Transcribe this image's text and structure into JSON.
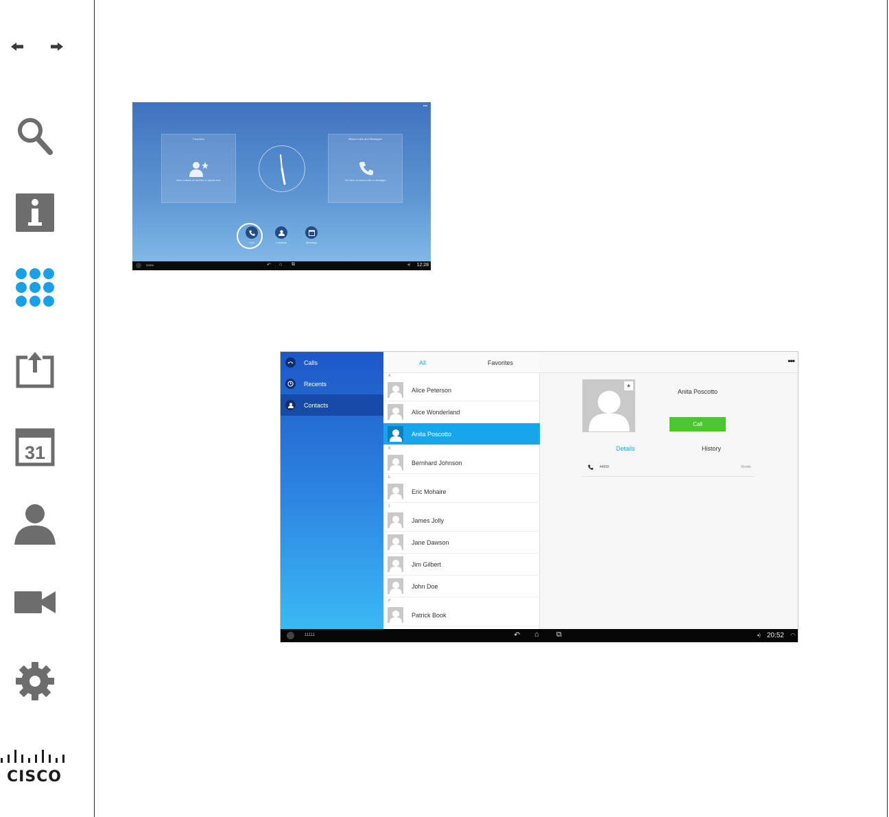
{
  "sidebar": {
    "icons": [
      "arrow-left-icon",
      "arrow-right-icon",
      "search-icon",
      "info-icon",
      "keypad-icon",
      "share-icon",
      "calendar-icon",
      "contact-icon",
      "camera-icon",
      "gear-icon"
    ],
    "calendar_number": "31",
    "info_letter": "i",
    "logo_text": "CISCO",
    "accent": "#1aa0e6",
    "icon_color": "#6d6d6d"
  },
  "home": {
    "panel_left": {
      "title": "Favorites",
      "text": "Mark contacts as favorites to appear here"
    },
    "panel_right": {
      "title": "Missed calls and Messages",
      "text": "You have no missed calls or messages"
    },
    "actions": [
      {
        "label": "Call",
        "icon": "phone-icon"
      },
      {
        "label": "Contacts",
        "icon": "contact-icon"
      },
      {
        "label": "Meetings",
        "icon": "calendar-icon"
      }
    ],
    "status": {
      "left": "92800",
      "time": "12:28"
    }
  },
  "contacts": {
    "tabs": [
      "Calls",
      "Recents",
      "Contacts"
    ],
    "selected_tab": "Contacts",
    "segments": {
      "all": "All",
      "favorites": "Favorites"
    },
    "letters": {
      "a": "A",
      "b": "B",
      "e": "E",
      "j": "J",
      "p": "P"
    },
    "list": [
      "Alice Peterson",
      "Alice Wonderland",
      "Anita Poscotto",
      "Bernhard Johnson",
      "Eric Mohaire",
      "James Jolly",
      "Jane Dawson",
      "Jim Gilbert",
      "John Doe",
      "Patrick Book"
    ],
    "selected_contact": "Anita Poscotto",
    "detail": {
      "name": "Anita Poscotto",
      "call_label": "Call",
      "tab_details": "Details",
      "tab_history": "History",
      "number": "44600",
      "number_type": "Mobile",
      "more": "•••"
    },
    "status": {
      "left": "11111",
      "time": "20:52"
    },
    "colors": {
      "call_green": "#4cc533",
      "select_blue": "#17a6ec"
    }
  }
}
